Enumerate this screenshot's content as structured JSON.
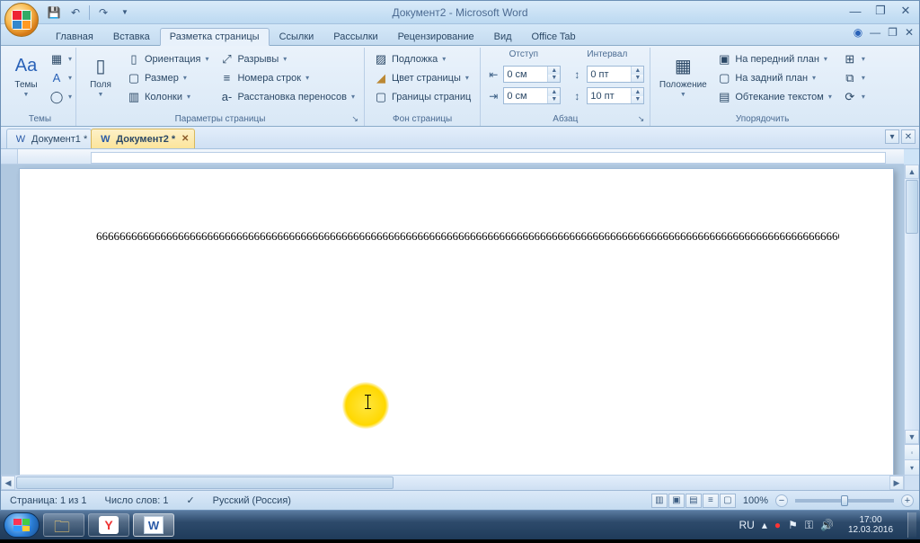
{
  "window": {
    "title": "Документ2 - Microsoft Word"
  },
  "qat": {
    "save_icon": "💾",
    "undo_icon": "↶",
    "redo_icon": "↷"
  },
  "ribbon": {
    "tabs": {
      "home": "Главная",
      "insert": "Вставка",
      "layout": "Разметка страницы",
      "references": "Ссылки",
      "mailings": "Рассылки",
      "review": "Рецензирование",
      "view": "Вид",
      "office_tab": "Office Tab"
    },
    "themes_group": {
      "label": "Темы",
      "themes": "Темы"
    },
    "page_setup": {
      "label": "Параметры страницы",
      "margins": "Поля",
      "orientation": "Ориентация",
      "size": "Размер",
      "columns": "Колонки",
      "breaks": "Разрывы",
      "line_numbers": "Номера строк",
      "hyphenation": "Расстановка переносов"
    },
    "page_bg": {
      "label": "Фон страницы",
      "watermark": "Подложка",
      "color": "Цвет страницы",
      "borders": "Границы страниц"
    },
    "paragraph": {
      "label": "Абзац",
      "indent_hdr": "Отступ",
      "spacing_hdr": "Интервал",
      "indent_left": "0 см",
      "indent_right": "0 см",
      "space_before": "0 пт",
      "space_after": "10 пт"
    },
    "arrange": {
      "label": "Упорядочить",
      "position": "Положение",
      "bring_front": "На передний план",
      "send_back": "На задний план",
      "text_wrap": "Обтекание текстом"
    }
  },
  "doc_tabs": {
    "tab1": "Документ1 *",
    "tab2": "Документ2 *"
  },
  "document": {
    "body_text": "666666666666666666666666666666666666666666666666666666666666666666666666666666666666666666666666666666666666666666666666666666666"
  },
  "status": {
    "page": "Страница: 1 из 1",
    "words": "Число слов: 1",
    "language": "Русский (Россия)",
    "zoom": "100%"
  },
  "tray": {
    "lang": "RU",
    "time": "17:00",
    "date": "12.03.2016"
  }
}
